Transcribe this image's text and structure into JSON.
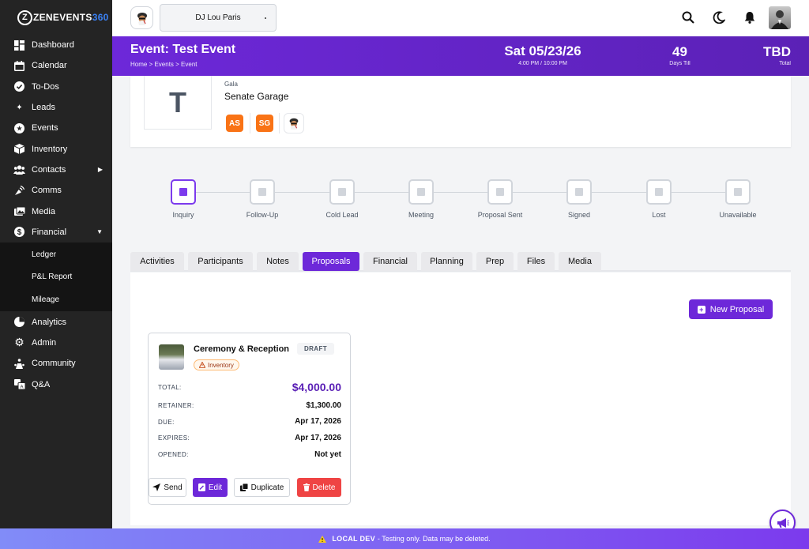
{
  "brand": {
    "prefix": "Z",
    "name": "ZENEVENTS",
    "number": "360"
  },
  "sidebar": {
    "items": [
      {
        "label": "Dashboard",
        "icon": "dashboard-icon"
      },
      {
        "label": "Calendar",
        "icon": "calendar-icon"
      },
      {
        "label": "To-Dos",
        "icon": "check-circle-icon"
      },
      {
        "label": "Leads",
        "icon": "stars-icon"
      },
      {
        "label": "Events",
        "icon": "star-circle-icon"
      },
      {
        "label": "Inventory",
        "icon": "box-icon"
      },
      {
        "label": "Contacts",
        "icon": "users-icon",
        "expander": "▶"
      },
      {
        "label": "Comms",
        "icon": "satellite-icon"
      },
      {
        "label": "Media",
        "icon": "photo-icon"
      },
      {
        "label": "Financial",
        "icon": "dollar-icon",
        "expander": "▼"
      }
    ],
    "financial_sub": [
      "Ledger",
      "P&L Report",
      "Mileage"
    ],
    "lower_items": [
      {
        "label": "Analytics",
        "icon": "chart-icon"
      },
      {
        "label": "Admin",
        "icon": "gear-icon"
      },
      {
        "label": "Community",
        "icon": "community-icon"
      },
      {
        "label": "Q&A",
        "icon": "translate-icon"
      }
    ]
  },
  "topbar": {
    "profile": "DJ Lou Paris"
  },
  "header": {
    "title": "Event: Test Event",
    "breadcrumb": "Home > Events > Event",
    "date": "Sat 05/23/26",
    "time": "4:00 PM / 10:00 PM",
    "days_value": "49",
    "days_label": "Days Till",
    "total_value": "TBD",
    "total_label": "Total"
  },
  "event": {
    "initial": "T",
    "type": "Gala",
    "venue": "Senate Garage",
    "chips": [
      "AS",
      "SG"
    ]
  },
  "stepper": {
    "steps": [
      "Inquiry",
      "Follow-Up",
      "Cold Lead",
      "Meeting",
      "Proposal Sent",
      "Signed",
      "Lost",
      "Unavailable"
    ],
    "active": "Inquiry"
  },
  "tabs": [
    "Activities",
    "Participants",
    "Notes",
    "Proposals",
    "Financial",
    "Planning",
    "Prep",
    "Files",
    "Media"
  ],
  "active_tab": "Proposals",
  "proposals": {
    "new_label": "New Proposal",
    "card": {
      "title": "Ceremony & Reception",
      "status": "DRAFT",
      "tag": "Inventory",
      "rows": [
        {
          "label": "TOTAL:",
          "value": "$4,000.00"
        },
        {
          "label": "RETAINER:",
          "value": "$1,300.00"
        },
        {
          "label": "DUE:",
          "value": "Apr 17, 2026"
        },
        {
          "label": "EXPIRES:",
          "value": "Apr 17, 2026"
        },
        {
          "label": "OPENED:",
          "value": "Not yet"
        }
      ],
      "actions": {
        "send": "Send",
        "edit": "Edit",
        "duplicate": "Duplicate",
        "delete": "Delete"
      }
    }
  },
  "devbar": {
    "badge": "LOCAL DEV",
    "text": "- Testing only. Data may be deleted."
  },
  "colors": {
    "accent": "#6d28d9",
    "sidebar": "#242424",
    "chip": "#f97316",
    "danger": "#ef4444"
  }
}
